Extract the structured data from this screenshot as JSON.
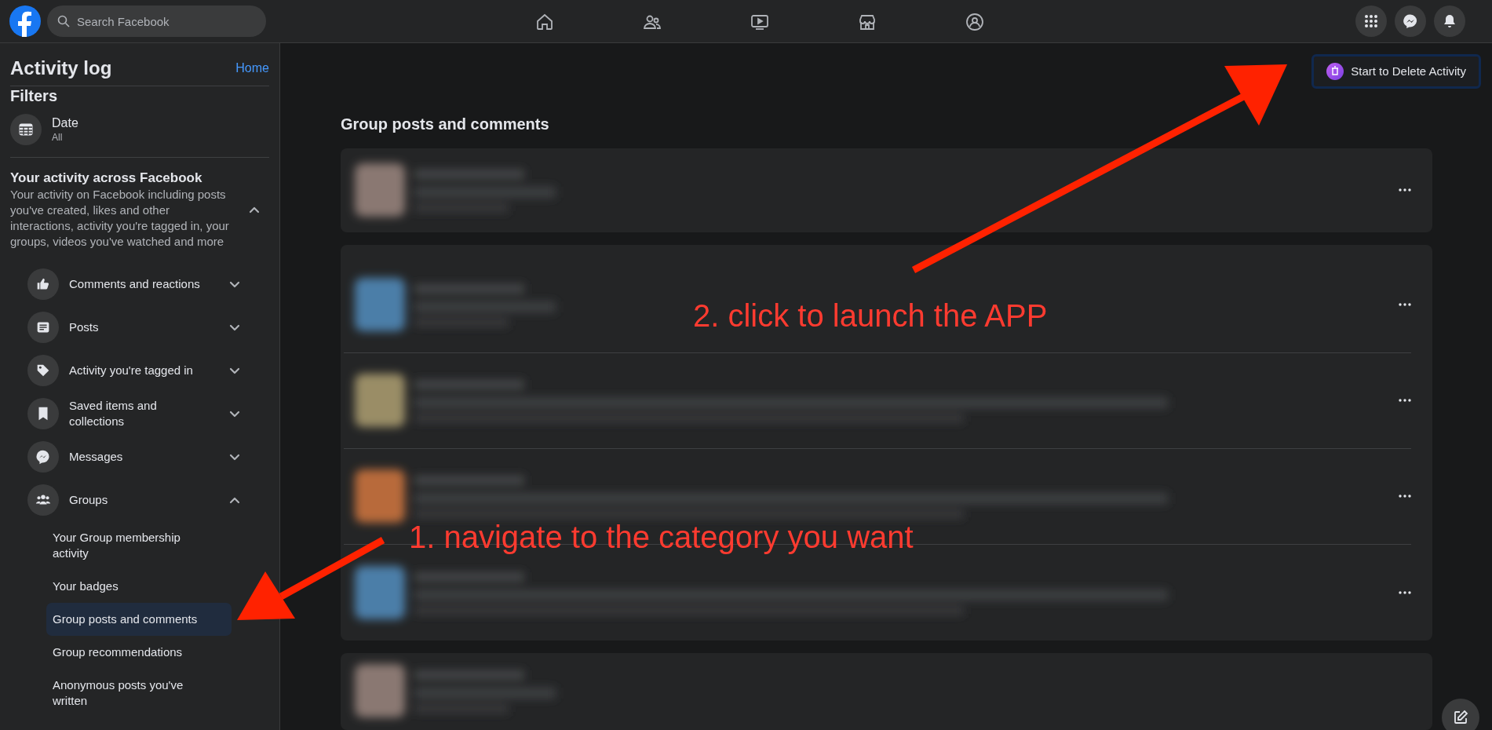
{
  "topbar": {
    "search": {
      "placeholder": "Search Facebook"
    }
  },
  "sidebar": {
    "title": "Activity log",
    "home_link": "Home",
    "filters_title": "Filters",
    "date_filter": {
      "label": "Date",
      "value": "All"
    },
    "section": {
      "title": "Your activity across Facebook",
      "description": "Your activity on Facebook including posts you've created, likes and other interactions, activity you're tagged in, your groups, videos you've watched and more",
      "expanded": true
    },
    "categories": [
      {
        "label": "Comments and reactions",
        "expanded": false
      },
      {
        "label": "Posts",
        "expanded": false
      },
      {
        "label": "Activity you're tagged in",
        "expanded": false
      },
      {
        "label": "Saved items and collections",
        "expanded": false
      },
      {
        "label": "Messages",
        "expanded": false
      },
      {
        "label": "Groups",
        "expanded": true,
        "children": [
          {
            "label": "Your Group membership activity",
            "selected": false
          },
          {
            "label": "Your badges",
            "selected": false
          },
          {
            "label": "Group posts and comments",
            "selected": true
          },
          {
            "label": "Group recommendations",
            "selected": false
          },
          {
            "label": "Anonymous posts you've written",
            "selected": false
          }
        ]
      }
    ]
  },
  "main": {
    "delete_button": "Start to Delete Activity",
    "heading": "Group posts and comments"
  },
  "annotations": [
    "2. click to launch the APP",
    "1. navigate to the category you want"
  ]
}
